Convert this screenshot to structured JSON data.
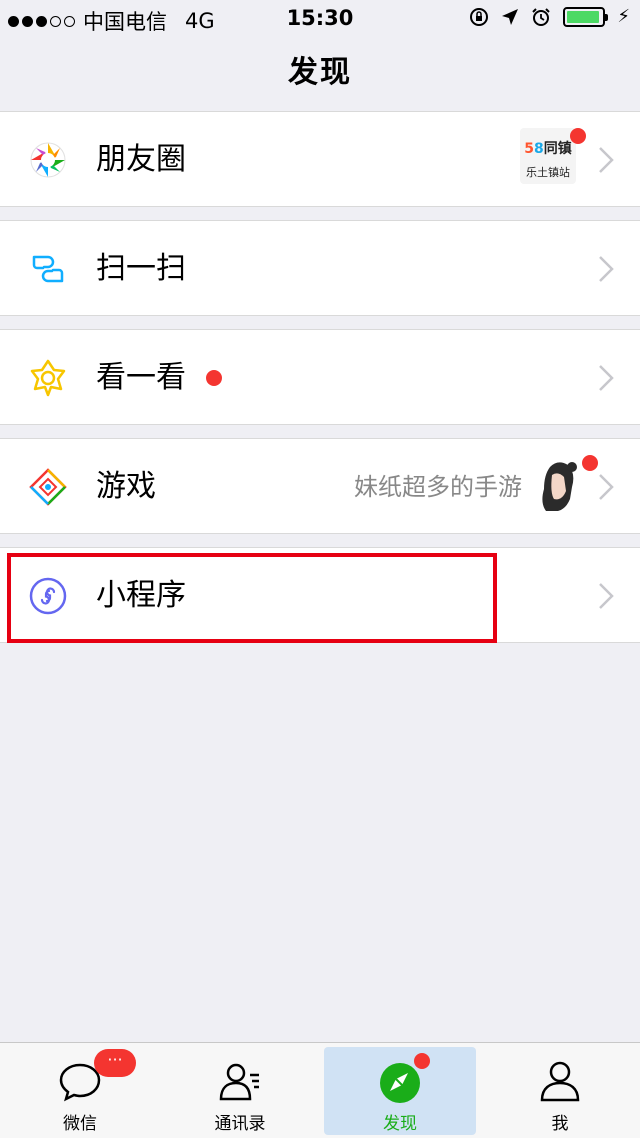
{
  "status_bar": {
    "carrier": "中国电信",
    "network": "4G",
    "time": "15:30",
    "signal_bars_filled": 3,
    "signal_bars_total": 5,
    "battery_level": 0.92,
    "charging_symbol": "⚡"
  },
  "nav": {
    "title": "发现"
  },
  "items": [
    {
      "label": "朋友圈",
      "icon": "moments-aperture-icon",
      "thumb_brand_5": "5",
      "thumb_brand_8": "8",
      "thumb_line1": "同镇",
      "thumb_line2": "乐土镇站"
    },
    {
      "label": "扫一扫",
      "icon": "scan-icon"
    },
    {
      "label": "看一看",
      "icon": "top-stories-icon"
    },
    {
      "label": "游戏",
      "icon": "games-icon",
      "desc": "妹纸超多的手游"
    },
    {
      "label": "小程序",
      "icon": "mini-programs-icon"
    }
  ],
  "tabs": [
    {
      "label": "微信",
      "icon": "chat-bubble-icon",
      "badge": "···"
    },
    {
      "label": "通讯录",
      "icon": "contacts-icon"
    },
    {
      "label": "发现",
      "icon": "compass-icon",
      "active": true
    },
    {
      "label": "我",
      "icon": "person-icon"
    }
  ],
  "colors": {
    "accent_green": "#1aad19",
    "badge_red": "#f43530",
    "highlight_red": "#e60012"
  }
}
